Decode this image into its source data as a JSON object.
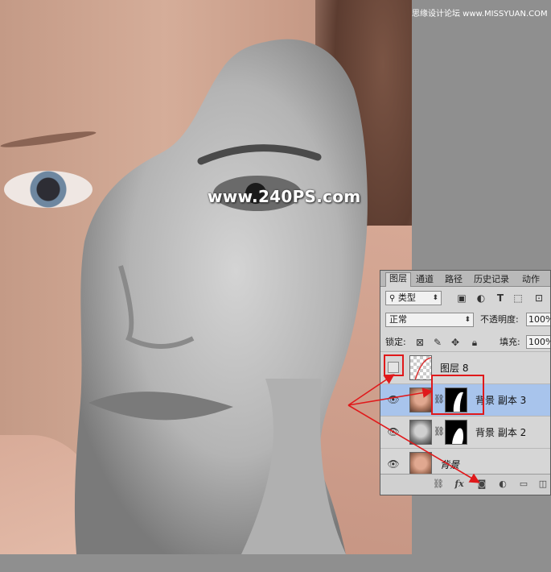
{
  "image": {
    "watermark": "www.240PS.com",
    "site_logo": "思缘设计论坛 www.MISSYUAN.COM"
  },
  "layers_panel": {
    "tabs": [
      {
        "label": "图层",
        "active": true
      },
      {
        "label": "通道",
        "active": false
      },
      {
        "label": "路径",
        "active": false
      },
      {
        "label": "历史记录",
        "active": false
      },
      {
        "label": "动作",
        "active": false
      }
    ],
    "filter": {
      "search_icon": "search-icon",
      "label": "类型"
    },
    "blend_mode": "正常",
    "opacity_label": "不透明度:",
    "opacity_value": "100%",
    "lock_label": "锁定:",
    "fill_label": "填充:",
    "fill_value": "100%",
    "layers": [
      {
        "name": "图层 8",
        "visible": false,
        "selected": false,
        "has_mask": false
      },
      {
        "name": "背景 副本 3",
        "visible": true,
        "selected": true,
        "has_mask": true
      },
      {
        "name": "背景 副本 2",
        "visible": true,
        "selected": false,
        "has_mask": true
      },
      {
        "name": "背景",
        "visible": true,
        "selected": false,
        "has_mask": false
      }
    ],
    "footer_fx": "fx"
  },
  "colors": {
    "annotation_red": "#e0191b",
    "selected_layer": "#a8c4ec",
    "panel_bg": "#d6d6d6"
  }
}
